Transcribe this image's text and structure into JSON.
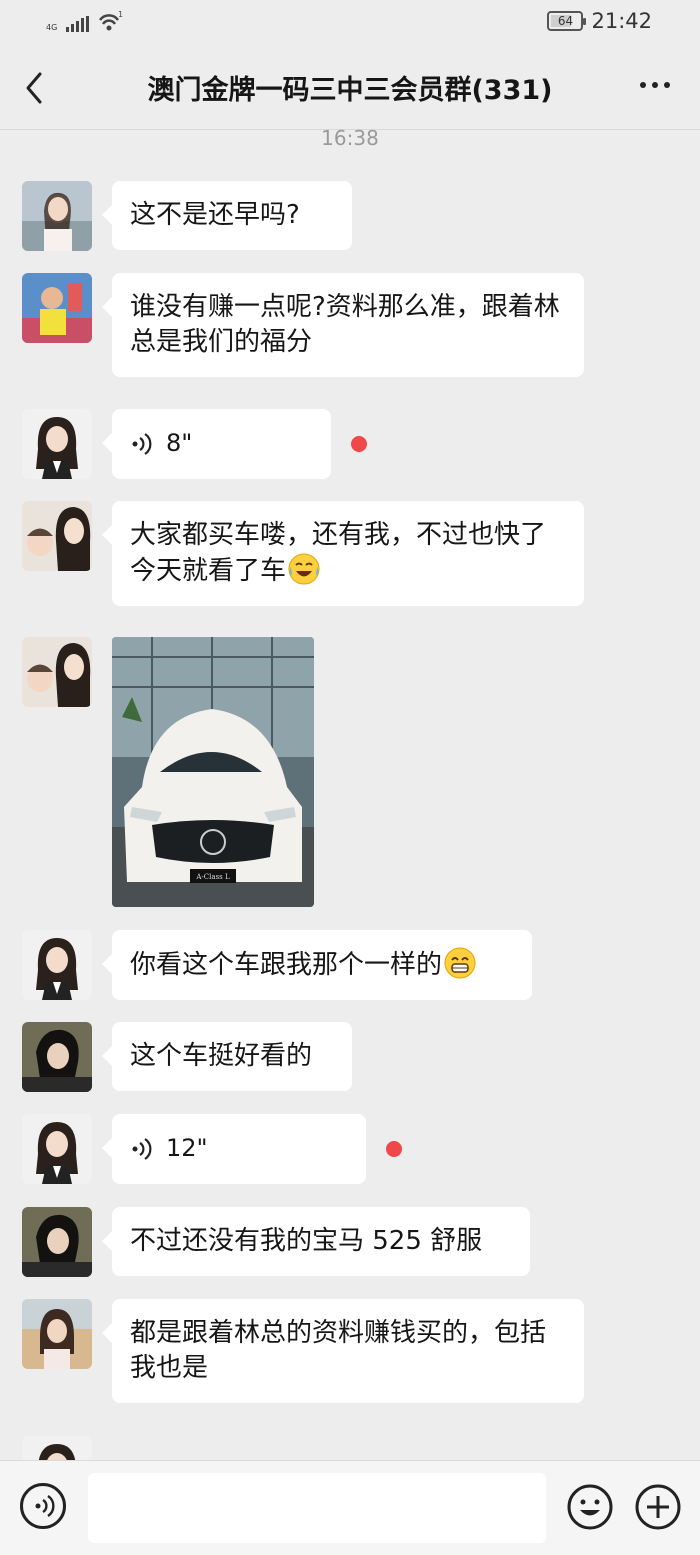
{
  "status": {
    "network": "4G",
    "wifi_badge": "1",
    "battery": "64",
    "time": "21:42"
  },
  "header": {
    "title": "澳门金牌一码三中三会员群(331)"
  },
  "chat": {
    "timestamp": "16:38",
    "messages": [
      {
        "text": "这不是还早吗?"
      },
      {
        "text": "谁没有赚一点呢?资料那么准，跟着林总是我们的福分"
      },
      {
        "duration": "8\""
      },
      {
        "text": "大家都买车喽，还有我，不过也快了今天就看了车"
      },
      {
        "image": "car-photo",
        "plate": "A-Class L"
      },
      {
        "text": "你看这个车跟我那个一样的"
      },
      {
        "text": "这个车挺好看的"
      },
      {
        "duration": "12\""
      },
      {
        "text": "不过还没有我的宝马 525 舒服"
      },
      {
        "text": "都是跟着林总的资料赚钱买的，包括我也是"
      }
    ]
  },
  "colors": {
    "background": "#ededed",
    "bubble": "#ffffff",
    "unread_dot": "#f04848"
  }
}
